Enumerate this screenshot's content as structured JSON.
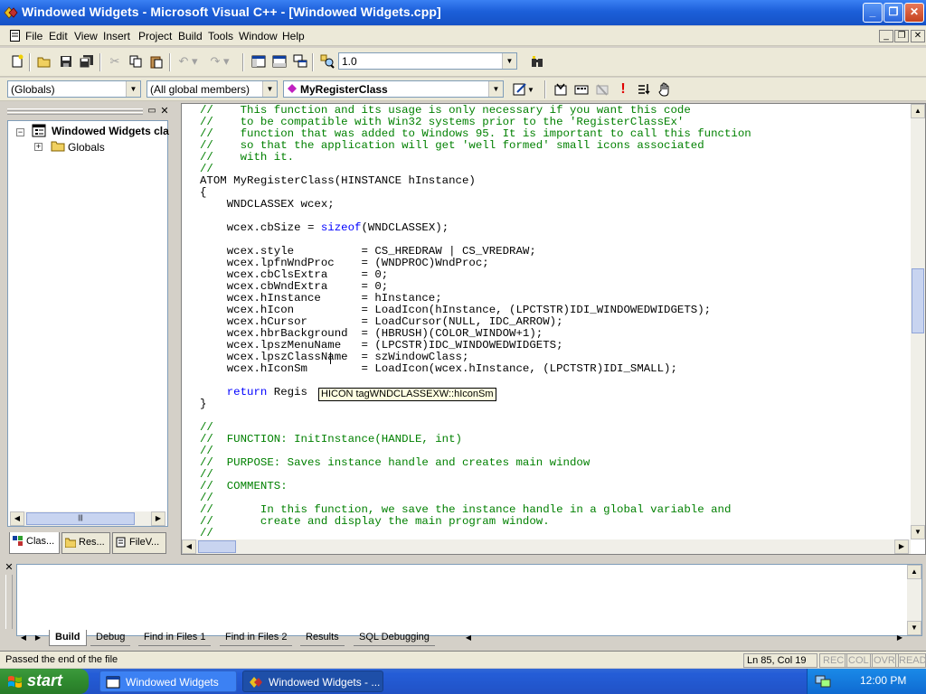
{
  "window": {
    "title": "Windowed Widgets - Microsoft Visual C++ - [Windowed Widgets.cpp]",
    "controls": {
      "minimize": "_",
      "maximize": "❐",
      "close": "✕"
    }
  },
  "menu": {
    "items": [
      "File",
      "Edit",
      "View",
      "Insert",
      "Project",
      "Build",
      "Tools",
      "Window",
      "Help"
    ]
  },
  "toolbar": {
    "find_combo_value": "1.0"
  },
  "wizardbar": {
    "class_combo": "(Globals)",
    "filter_combo": "(All global members)",
    "member_combo": "MyRegisterClass"
  },
  "workspace": {
    "tree_root": "Windowed Widgets cla",
    "tree_child": "Globals",
    "tabs": [
      "Clas...",
      "Res...",
      "FileV..."
    ]
  },
  "editor": {
    "lines": [
      "//    This function and its usage is only necessary if you want this code",
      "//    to be compatible with Win32 systems prior to the 'RegisterClassEx'",
      "//    function that was added to Windows 95. It is important to call this function",
      "//    so that the application will get 'well formed' small icons associated",
      "//    with it.",
      "//",
      "ATOM MyRegisterClass(HINSTANCE hInstance)",
      "{",
      "    WNDCLASSEX wcex;",
      "",
      "    wcex.cbSize = sizeof(WNDCLASSEX);",
      "",
      "    wcex.style          = CS_HREDRAW | CS_VREDRAW;",
      "    wcex.lpfnWndProc    = (WNDPROC)WndProc;",
      "    wcex.cbClsExtra     = 0;",
      "    wcex.cbWndExtra     = 0;",
      "    wcex.hInstance      = hInstance;",
      "    wcex.hIcon          = LoadIcon(hInstance, (LPCTSTR)IDI_WINDOWEDWIDGETS);",
      "    wcex.hCursor        = LoadCursor(NULL, IDC_ARROW);",
      "    wcex.hbrBackground  = (HBRUSH)(COLOR_WINDOW+1);",
      "    wcex.lpszMenuName   = (LPCSTR)IDC_WINDOWEDWIDGETS;",
      "    wcex.lpszClassName  = szWindowClass;",
      "    wcex.hIconSm        = LoadIcon(wcex.hInstance, (LPCTSTR)IDI_SMALL);",
      "",
      "    return Regis",
      "}",
      "",
      "//",
      "//  FUNCTION: InitInstance(HANDLE, int)",
      "//",
      "//  PURPOSE: Saves instance handle and creates main window",
      "//",
      "//  COMMENTS:",
      "//",
      "//       In this function, we save the instance handle in a global variable and",
      "//       create and display the main program window.",
      "//"
    ],
    "tooltip": "HICON tagWNDCLASSEXW::hIconSm"
  },
  "output": {
    "tabs": [
      "Build",
      "Debug",
      "Find in Files 1",
      "Find in Files 2",
      "Results",
      "SQL Debugging"
    ]
  },
  "status": {
    "message": "Passed the end of the file",
    "position": "Ln 85, Col 19",
    "indicators": [
      "REC",
      "COL",
      "OVR",
      "READ"
    ]
  },
  "taskbar": {
    "start": "start",
    "tasks": [
      "Windowed Widgets",
      "Windowed Widgets - ..."
    ],
    "clock": "12:00 PM"
  }
}
